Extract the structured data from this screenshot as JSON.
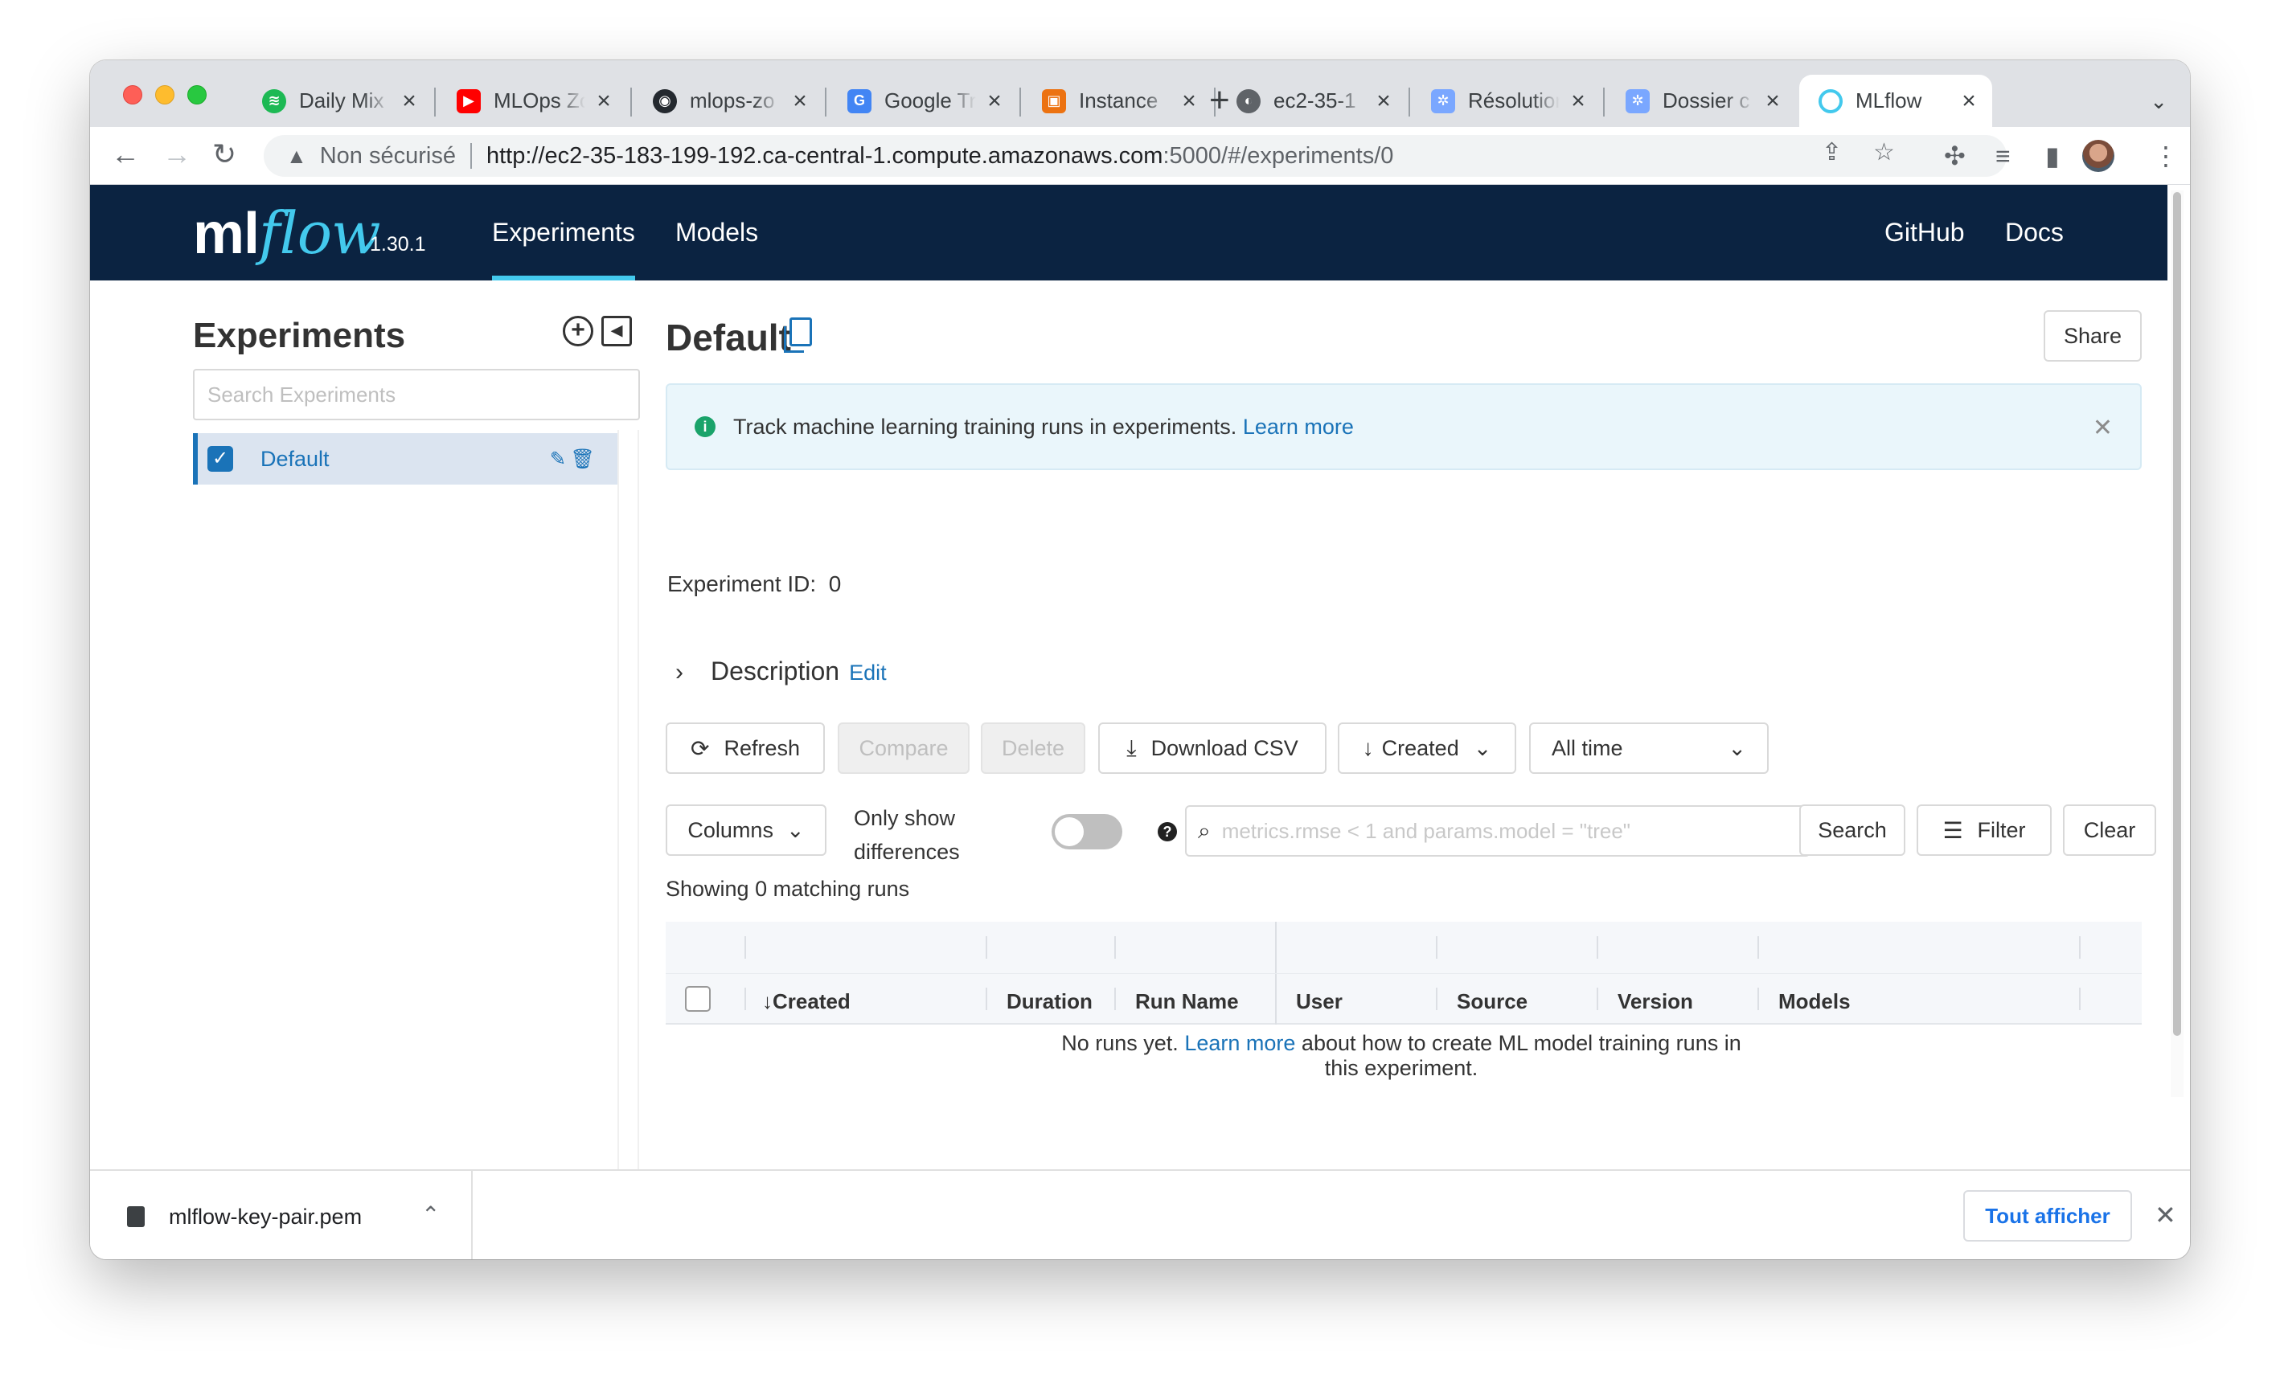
{
  "browser": {
    "tabs": [
      {
        "title": "Daily Mix",
        "favicon": "spotify-icon",
        "color": "#1db954"
      },
      {
        "title": "MLOps Zo",
        "favicon": "youtube-icon",
        "color": "#ff0000"
      },
      {
        "title": "mlops-zo",
        "favicon": "github-icon",
        "color": "#24292f"
      },
      {
        "title": "Google Tr",
        "favicon": "google-translate-icon",
        "color": "#4285f4"
      },
      {
        "title": "Instance",
        "favicon": "aws-icon",
        "color": "#ec7211"
      },
      {
        "title": "ec2-35-1",
        "favicon": "globe-icon",
        "color": "#5f6368"
      },
      {
        "title": "Résolution",
        "favicon": "kubernetes-icon",
        "color": "#7aa7ff"
      },
      {
        "title": "Dossier c",
        "favicon": "kubernetes-icon",
        "color": "#7aa7ff"
      },
      {
        "title": "MLflow",
        "favicon": "mlflow-icon",
        "color": "#43c9ed",
        "active": true
      }
    ],
    "address": {
      "warning": "Non sécurisé",
      "url_host": "http://ec2-35-183-199-192.ca-central-1.compute.amazonaws.com",
      "url_rest": ":5000/#/experiments/0"
    }
  },
  "header": {
    "logo_ml": "ml",
    "logo_flow": "flow",
    "version": "1.30.1",
    "nav": {
      "experiments": "Experiments",
      "models": "Models",
      "github": "GitHub",
      "docs": "Docs"
    },
    "colors": {
      "background": "#0b2341",
      "accent": "#43c9ed"
    }
  },
  "sidebar": {
    "title": "Experiments",
    "search_placeholder": "Search Experiments",
    "experiments": [
      {
        "name": "Default",
        "selected": true
      }
    ]
  },
  "main": {
    "title": "Default",
    "share_label": "Share",
    "banner": {
      "text": "Track machine learning training runs in experiments.",
      "link": "Learn more"
    },
    "experiment_id_label": "Experiment ID:",
    "experiment_id": "0",
    "description_label": "Description",
    "description_edit": "Edit",
    "buttons": {
      "refresh": "Refresh",
      "compare": "Compare",
      "delete": "Delete",
      "download_csv": "Download CSV",
      "sort": "Created",
      "time_range": "All time",
      "columns": "Columns",
      "search": "Search",
      "filter": "Filter",
      "clear": "Clear"
    },
    "only_show_line1": "Only show",
    "only_show_line2": "differences",
    "search_placeholder": "metrics.rmse < 1 and params.model = \"tree\"",
    "showing": "Showing 0 matching runs",
    "table_headers": [
      "Created",
      "Duration",
      "Run Name",
      "User",
      "Source",
      "Version",
      "Models"
    ],
    "empty": {
      "prefix": "No runs yet.",
      "link": "Learn more",
      "suffix": "about how to create ML model training runs in this experiment."
    }
  },
  "download_bar": {
    "file": "mlflow-key-pair.pem",
    "show_all": "Tout afficher"
  }
}
